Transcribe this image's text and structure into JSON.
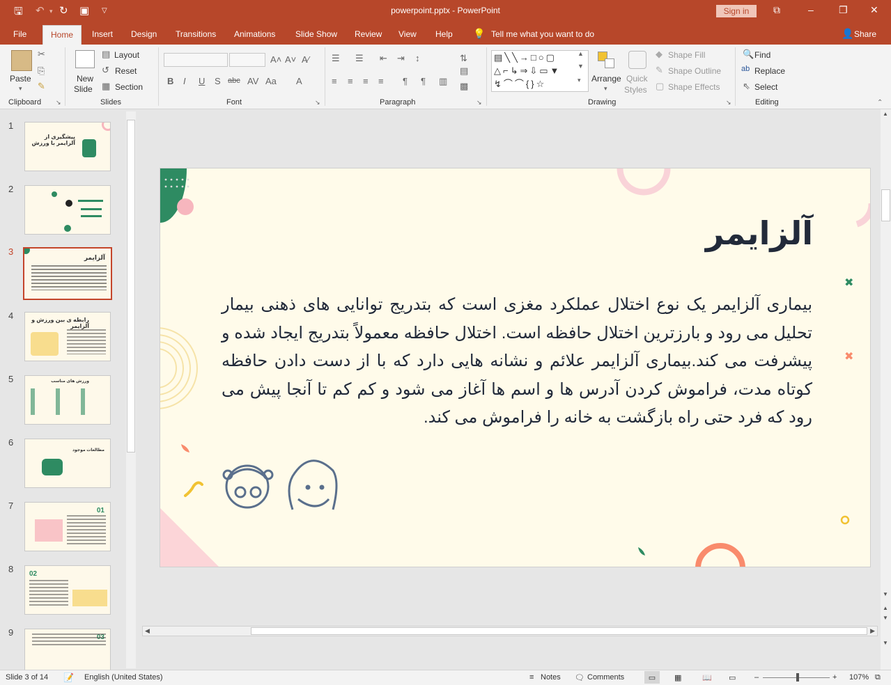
{
  "window": {
    "title": "powerpoint.pptx  -  PowerPoint",
    "sign_in": "Sign in"
  },
  "tabs": [
    "File",
    "Home",
    "Insert",
    "Design",
    "Transitions",
    "Animations",
    "Slide Show",
    "Review",
    "View",
    "Help"
  ],
  "tell_me": "Tell me what you want to do",
  "share": "Share",
  "ribbon": {
    "clipboard": {
      "paste": "Paste",
      "group": "Clipboard"
    },
    "slides": {
      "new_slide": "New",
      "new_slide2": "Slide",
      "layout": "Layout",
      "reset": "Reset",
      "section": "Section",
      "group": "Slides"
    },
    "font": {
      "group": "Font"
    },
    "paragraph": {
      "group": "Paragraph"
    },
    "drawing": {
      "arrange": "Arrange",
      "quick_styles": "Quick",
      "quick_styles2": "Styles",
      "shape_fill": "Shape Fill",
      "shape_outline": "Shape Outline",
      "shape_effects": "Shape Effects",
      "group": "Drawing"
    },
    "editing": {
      "find": "Find",
      "replace": "Replace",
      "select": "Select",
      "group": "Editing"
    }
  },
  "thumbnails": [
    {
      "num": "1",
      "title": "پیشگیری از آلزایمر با ورزش"
    },
    {
      "num": "2",
      "title": ""
    },
    {
      "num": "3",
      "title": "آلزایمر"
    },
    {
      "num": "4",
      "title": "رابطه ی بین ورزش و آلزایمر"
    },
    {
      "num": "5",
      "title": "ورزش های مناسب"
    },
    {
      "num": "6",
      "title": "مطالعات موجود"
    },
    {
      "num": "7",
      "title": "01"
    },
    {
      "num": "8",
      "title": "02"
    },
    {
      "num": "9",
      "title": "03"
    }
  ],
  "slide": {
    "title": "آلزایمر",
    "body": "بیماری آلزایمر یک نوع اختلال عملکرد مغزی است که بتدریج توانایی های ذهنی بیمار تحلیل می رود و بارزترین اختلال حافظه است. اختلال حافظه معمولاً بتدریج ایجاد شده و پیشرفت می کند.بیماری آلزایمر علائم و نشانه هایی دارد که با از دست دادن حافظه کوتاه مدت، فراموش کردن آدرس ها و اسم ها آغاز می شود و کم کم تا آنجا پیش می رود که فرد حتی راه بازگشت به خانه را فراموش می کند."
  },
  "status": {
    "slide": "Slide 3 of 14",
    "language": "English (United States)",
    "notes": "Notes",
    "comments": "Comments",
    "zoom": "107%"
  },
  "colors": {
    "accent": "#b7472a",
    "slide_bg": "#fffbea",
    "text": "#222a3a",
    "green": "#2e8b62",
    "pink": "#f7b6be",
    "coral": "#f98b6c"
  }
}
